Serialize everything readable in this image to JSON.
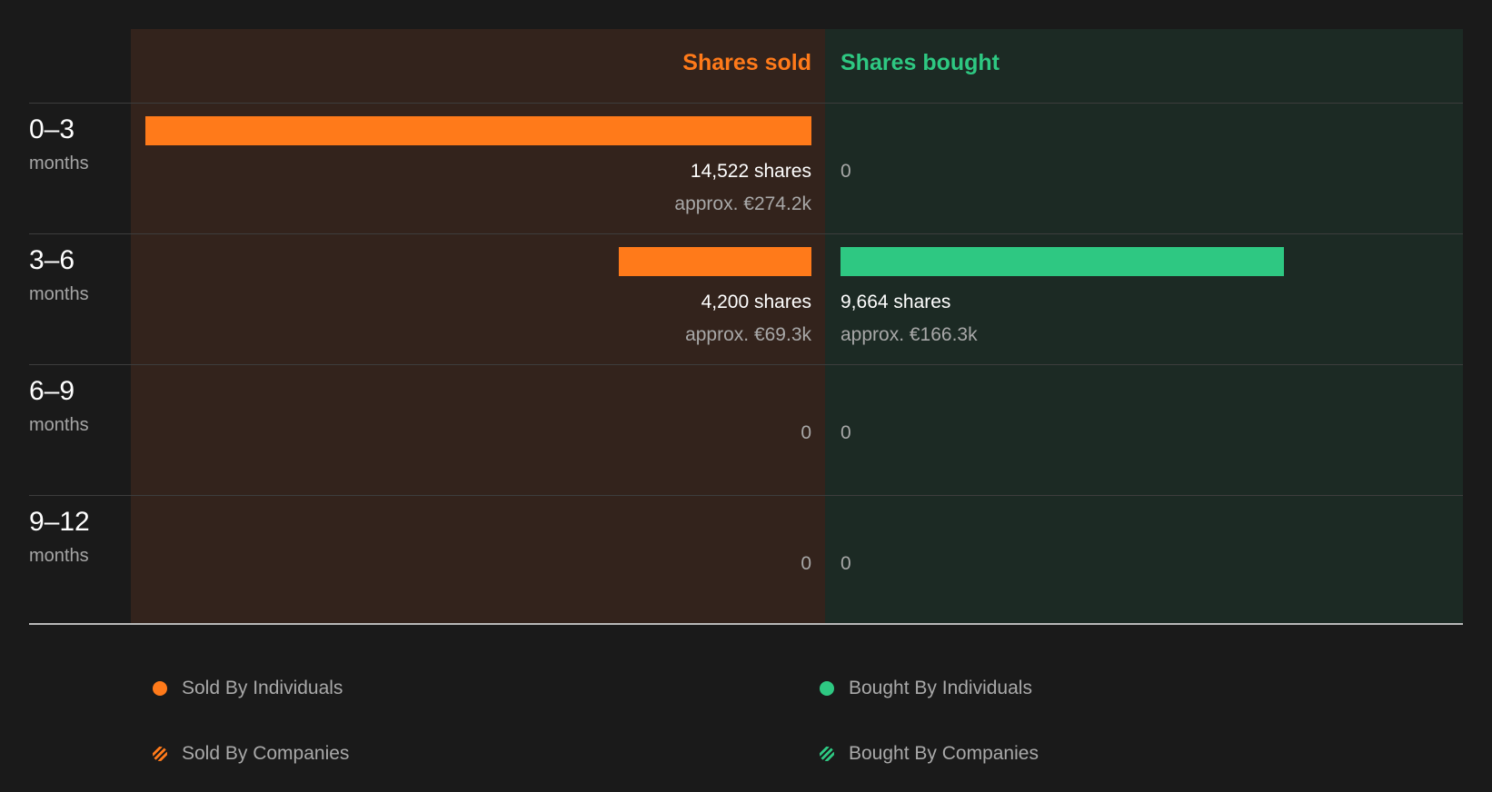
{
  "chart_data": {
    "type": "bar",
    "categories": [
      {
        "range": "0–3",
        "unit": "months"
      },
      {
        "range": "3–6",
        "unit": "months"
      },
      {
        "range": "6–9",
        "unit": "months"
      },
      {
        "range": "9–12",
        "unit": "months"
      }
    ],
    "headers": {
      "sold": "Shares sold",
      "bought": "Shares bought"
    },
    "series": [
      {
        "name": "Shares sold",
        "values": [
          14522,
          4200,
          0,
          0
        ],
        "labels": [
          "14,522 shares",
          "4,200 shares",
          "0",
          "0"
        ],
        "approx": [
          "approx. €274.2k",
          "approx. €69.3k",
          "",
          ""
        ]
      },
      {
        "name": "Shares bought",
        "values": [
          0,
          9664,
          0,
          0
        ],
        "labels": [
          "0",
          "9,664 shares",
          "0",
          "0"
        ],
        "approx": [
          "",
          "approx. €166.3k",
          "",
          ""
        ]
      }
    ],
    "legend": [
      {
        "label": "Sold By Individuals"
      },
      {
        "label": "Bought By Individuals"
      },
      {
        "label": "Sold By Companies"
      },
      {
        "label": "Bought By Companies"
      }
    ],
    "colors": {
      "sold": "#ff7a1a",
      "bought": "#2ec882"
    }
  }
}
